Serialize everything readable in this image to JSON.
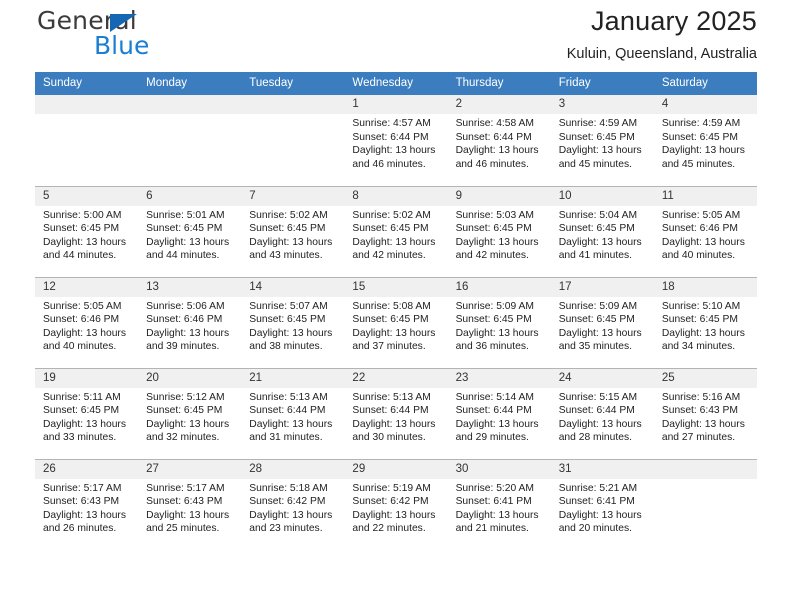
{
  "brand": {
    "name_part1": "General",
    "name_part2": "Blue",
    "accent_color": "#1a7fd4",
    "triangle_color": "#1567b3"
  },
  "header": {
    "title": "January 2025",
    "subtitle": "Kuluin, Queensland, Australia"
  },
  "calendar": {
    "header_bg": "#3b7dbf",
    "weekdays": [
      "Sunday",
      "Monday",
      "Tuesday",
      "Wednesday",
      "Thursday",
      "Friday",
      "Saturday"
    ],
    "weeks": [
      [
        {
          "day": "",
          "sunrise": "",
          "sunset": "",
          "daylight_line1": "",
          "daylight_line2": ""
        },
        {
          "day": "",
          "sunrise": "",
          "sunset": "",
          "daylight_line1": "",
          "daylight_line2": ""
        },
        {
          "day": "",
          "sunrise": "",
          "sunset": "",
          "daylight_line1": "",
          "daylight_line2": ""
        },
        {
          "day": "1",
          "sunrise": "Sunrise: 4:57 AM",
          "sunset": "Sunset: 6:44 PM",
          "daylight_line1": "Daylight: 13 hours",
          "daylight_line2": "and 46 minutes."
        },
        {
          "day": "2",
          "sunrise": "Sunrise: 4:58 AM",
          "sunset": "Sunset: 6:44 PM",
          "daylight_line1": "Daylight: 13 hours",
          "daylight_line2": "and 46 minutes."
        },
        {
          "day": "3",
          "sunrise": "Sunrise: 4:59 AM",
          "sunset": "Sunset: 6:45 PM",
          "daylight_line1": "Daylight: 13 hours",
          "daylight_line2": "and 45 minutes."
        },
        {
          "day": "4",
          "sunrise": "Sunrise: 4:59 AM",
          "sunset": "Sunset: 6:45 PM",
          "daylight_line1": "Daylight: 13 hours",
          "daylight_line2": "and 45 minutes."
        }
      ],
      [
        {
          "day": "5",
          "sunrise": "Sunrise: 5:00 AM",
          "sunset": "Sunset: 6:45 PM",
          "daylight_line1": "Daylight: 13 hours",
          "daylight_line2": "and 44 minutes."
        },
        {
          "day": "6",
          "sunrise": "Sunrise: 5:01 AM",
          "sunset": "Sunset: 6:45 PM",
          "daylight_line1": "Daylight: 13 hours",
          "daylight_line2": "and 44 minutes."
        },
        {
          "day": "7",
          "sunrise": "Sunrise: 5:02 AM",
          "sunset": "Sunset: 6:45 PM",
          "daylight_line1": "Daylight: 13 hours",
          "daylight_line2": "and 43 minutes."
        },
        {
          "day": "8",
          "sunrise": "Sunrise: 5:02 AM",
          "sunset": "Sunset: 6:45 PM",
          "daylight_line1": "Daylight: 13 hours",
          "daylight_line2": "and 42 minutes."
        },
        {
          "day": "9",
          "sunrise": "Sunrise: 5:03 AM",
          "sunset": "Sunset: 6:45 PM",
          "daylight_line1": "Daylight: 13 hours",
          "daylight_line2": "and 42 minutes."
        },
        {
          "day": "10",
          "sunrise": "Sunrise: 5:04 AM",
          "sunset": "Sunset: 6:45 PM",
          "daylight_line1": "Daylight: 13 hours",
          "daylight_line2": "and 41 minutes."
        },
        {
          "day": "11",
          "sunrise": "Sunrise: 5:05 AM",
          "sunset": "Sunset: 6:46 PM",
          "daylight_line1": "Daylight: 13 hours",
          "daylight_line2": "and 40 minutes."
        }
      ],
      [
        {
          "day": "12",
          "sunrise": "Sunrise: 5:05 AM",
          "sunset": "Sunset: 6:46 PM",
          "daylight_line1": "Daylight: 13 hours",
          "daylight_line2": "and 40 minutes."
        },
        {
          "day": "13",
          "sunrise": "Sunrise: 5:06 AM",
          "sunset": "Sunset: 6:46 PM",
          "daylight_line1": "Daylight: 13 hours",
          "daylight_line2": "and 39 minutes."
        },
        {
          "day": "14",
          "sunrise": "Sunrise: 5:07 AM",
          "sunset": "Sunset: 6:45 PM",
          "daylight_line1": "Daylight: 13 hours",
          "daylight_line2": "and 38 minutes."
        },
        {
          "day": "15",
          "sunrise": "Sunrise: 5:08 AM",
          "sunset": "Sunset: 6:45 PM",
          "daylight_line1": "Daylight: 13 hours",
          "daylight_line2": "and 37 minutes."
        },
        {
          "day": "16",
          "sunrise": "Sunrise: 5:09 AM",
          "sunset": "Sunset: 6:45 PM",
          "daylight_line1": "Daylight: 13 hours",
          "daylight_line2": "and 36 minutes."
        },
        {
          "day": "17",
          "sunrise": "Sunrise: 5:09 AM",
          "sunset": "Sunset: 6:45 PM",
          "daylight_line1": "Daylight: 13 hours",
          "daylight_line2": "and 35 minutes."
        },
        {
          "day": "18",
          "sunrise": "Sunrise: 5:10 AM",
          "sunset": "Sunset: 6:45 PM",
          "daylight_line1": "Daylight: 13 hours",
          "daylight_line2": "and 34 minutes."
        }
      ],
      [
        {
          "day": "19",
          "sunrise": "Sunrise: 5:11 AM",
          "sunset": "Sunset: 6:45 PM",
          "daylight_line1": "Daylight: 13 hours",
          "daylight_line2": "and 33 minutes."
        },
        {
          "day": "20",
          "sunrise": "Sunrise: 5:12 AM",
          "sunset": "Sunset: 6:45 PM",
          "daylight_line1": "Daylight: 13 hours",
          "daylight_line2": "and 32 minutes."
        },
        {
          "day": "21",
          "sunrise": "Sunrise: 5:13 AM",
          "sunset": "Sunset: 6:44 PM",
          "daylight_line1": "Daylight: 13 hours",
          "daylight_line2": "and 31 minutes."
        },
        {
          "day": "22",
          "sunrise": "Sunrise: 5:13 AM",
          "sunset": "Sunset: 6:44 PM",
          "daylight_line1": "Daylight: 13 hours",
          "daylight_line2": "and 30 minutes."
        },
        {
          "day": "23",
          "sunrise": "Sunrise: 5:14 AM",
          "sunset": "Sunset: 6:44 PM",
          "daylight_line1": "Daylight: 13 hours",
          "daylight_line2": "and 29 minutes."
        },
        {
          "day": "24",
          "sunrise": "Sunrise: 5:15 AM",
          "sunset": "Sunset: 6:44 PM",
          "daylight_line1": "Daylight: 13 hours",
          "daylight_line2": "and 28 minutes."
        },
        {
          "day": "25",
          "sunrise": "Sunrise: 5:16 AM",
          "sunset": "Sunset: 6:43 PM",
          "daylight_line1": "Daylight: 13 hours",
          "daylight_line2": "and 27 minutes."
        }
      ],
      [
        {
          "day": "26",
          "sunrise": "Sunrise: 5:17 AM",
          "sunset": "Sunset: 6:43 PM",
          "daylight_line1": "Daylight: 13 hours",
          "daylight_line2": "and 26 minutes."
        },
        {
          "day": "27",
          "sunrise": "Sunrise: 5:17 AM",
          "sunset": "Sunset: 6:43 PM",
          "daylight_line1": "Daylight: 13 hours",
          "daylight_line2": "and 25 minutes."
        },
        {
          "day": "28",
          "sunrise": "Sunrise: 5:18 AM",
          "sunset": "Sunset: 6:42 PM",
          "daylight_line1": "Daylight: 13 hours",
          "daylight_line2": "and 23 minutes."
        },
        {
          "day": "29",
          "sunrise": "Sunrise: 5:19 AM",
          "sunset": "Sunset: 6:42 PM",
          "daylight_line1": "Daylight: 13 hours",
          "daylight_line2": "and 22 minutes."
        },
        {
          "day": "30",
          "sunrise": "Sunrise: 5:20 AM",
          "sunset": "Sunset: 6:41 PM",
          "daylight_line1": "Daylight: 13 hours",
          "daylight_line2": "and 21 minutes."
        },
        {
          "day": "31",
          "sunrise": "Sunrise: 5:21 AM",
          "sunset": "Sunset: 6:41 PM",
          "daylight_line1": "Daylight: 13 hours",
          "daylight_line2": "and 20 minutes."
        },
        {
          "day": "",
          "sunrise": "",
          "sunset": "",
          "daylight_line1": "",
          "daylight_line2": ""
        }
      ]
    ]
  }
}
